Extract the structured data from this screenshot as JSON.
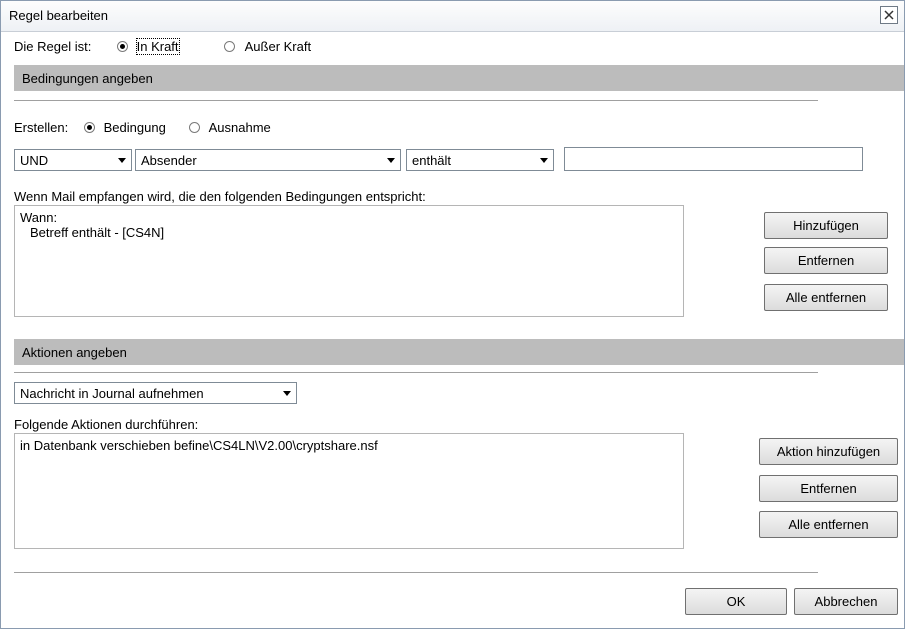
{
  "window": {
    "title": "Regel bearbeiten",
    "close_glyph": "close-icon"
  },
  "status": {
    "label": "Die Regel ist:",
    "option_active": "In Kraft",
    "option_inactive": "Außer Kraft",
    "selected": "In Kraft"
  },
  "conditions": {
    "header": "Bedingungen angeben",
    "create_label": "Erstellen:",
    "create_condition": "Bedingung",
    "create_exception": "Ausnahme",
    "create_selected": "Bedingung",
    "operator_value": "UND",
    "field_value": "Absender",
    "comparison_value": "enthält",
    "text_value": "",
    "list_label": "Wenn Mail empfangen wird, die den folgenden Bedingungen entspricht:",
    "list_items": [
      "Wann:",
      "Betreff enthält  - [CS4N]"
    ],
    "add_button": "Hinzufügen",
    "remove_button": "Entfernen",
    "remove_all_button": "Alle entfernen"
  },
  "actions": {
    "header": "Aktionen angeben",
    "action_type_value": "Nachricht in Journal aufnehmen",
    "list_label": "Folgende Aktionen durchführen:",
    "list_items": [
      "in Datenbank verschieben befine\\CS4LN\\V2.00\\cryptshare.nsf"
    ],
    "add_button": "Aktion hinzufügen",
    "remove_button": "Entfernen",
    "remove_all_button": "Alle entfernen"
  },
  "footer": {
    "ok_button": "OK",
    "cancel_button": "Abbrechen"
  }
}
